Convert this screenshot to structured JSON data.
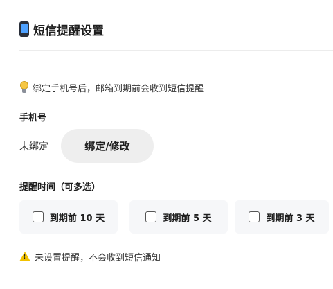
{
  "header": {
    "title": "短信提醒设置",
    "icon": "phone-icon"
  },
  "tip": {
    "text": "绑定手机号后，邮箱到期前会收到短信提醒",
    "icon": "lightbulb-icon"
  },
  "phone": {
    "label": "手机号",
    "status": "未绑定",
    "bind_button": "绑定/修改"
  },
  "remind": {
    "label": "提醒时间（可多选）",
    "options": [
      {
        "label": "到期前 10 天",
        "checked": false
      },
      {
        "label": "到期前 5 天",
        "checked": false
      },
      {
        "label": "到期前 3 天",
        "checked": false
      }
    ]
  },
  "warning": {
    "text": "未设置提醒，不会收到短信通知",
    "icon": "warning-icon"
  }
}
